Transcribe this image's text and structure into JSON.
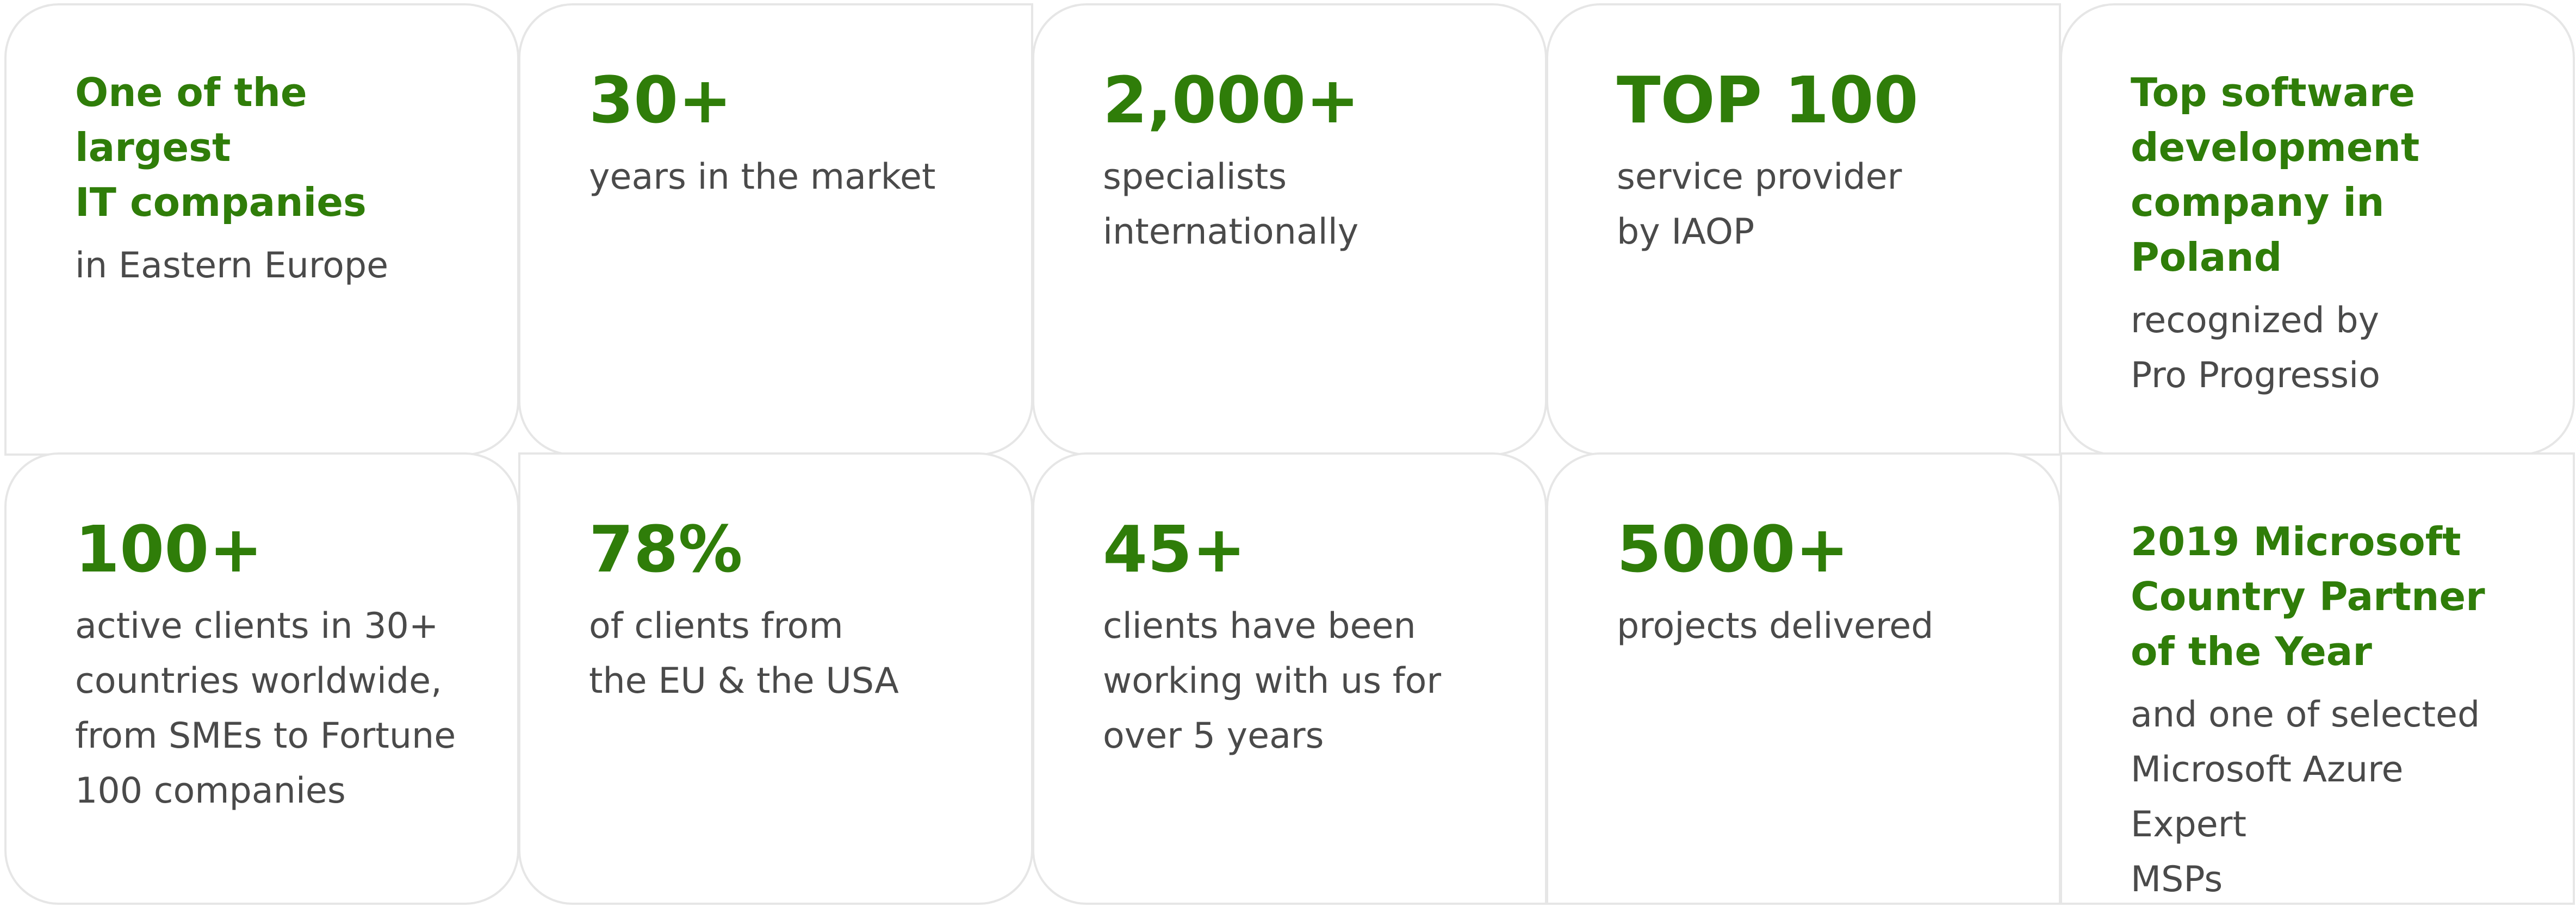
{
  "colors": {
    "accent": "#2f7d09",
    "text": "#4a4a4a",
    "border": "#e6e6e6"
  },
  "stats": [
    {
      "headline": "One of the largest\nIT companies",
      "desc": "in Eastern Europe"
    },
    {
      "headline": "30+",
      "desc": "years in the market"
    },
    {
      "headline": "2,000+",
      "desc": "specialists\ninternationally"
    },
    {
      "headline": "TOP 100",
      "desc": "service provider\nby IAOP"
    },
    {
      "headline": "Top software\ndevelopment\ncompany in Poland",
      "desc": "recognized by\nPro Progressio"
    },
    {
      "headline": "100+",
      "desc": "active clients in 30+\ncountries worldwide,\nfrom SMEs to Fortune\n100 companies"
    },
    {
      "headline": "78%",
      "desc": "of clients from\nthe EU & the USA"
    },
    {
      "headline": "45+",
      "desc": "clients have been\nworking with us for\nover 5 years"
    },
    {
      "headline": "5000+",
      "desc": "projects delivered"
    },
    {
      "headline": "2019 Microsoft\nCountry Partner\nof the Year",
      "desc": "and one of selected\nMicrosoft Azure Expert\nMSPs"
    }
  ]
}
